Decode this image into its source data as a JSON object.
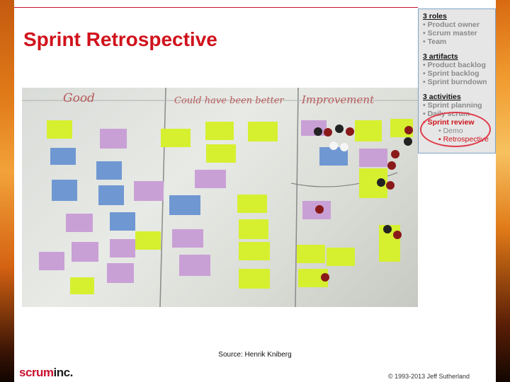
{
  "slide": {
    "title": "Sprint Retrospective",
    "source": "Source: Henrik Kniberg",
    "copyright": "© 1993-2013 Jeff Sutherland"
  },
  "logo": {
    "part1": "scrum",
    "part2": "inc."
  },
  "nav": {
    "groups": [
      {
        "heading": "3 roles",
        "items": [
          "• Product owner",
          "• Scrum master",
          "• Team"
        ]
      },
      {
        "heading": "3 artifacts",
        "items": [
          "• Product backlog",
          "• Sprint backlog",
          "• Sprint burndown"
        ]
      },
      {
        "heading": "3 activities",
        "items": [
          "• Sprint planning",
          "• Daily scrum",
          "• Sprint review"
        ]
      }
    ],
    "subitems": [
      "• Demo",
      "• Retrospective"
    ]
  },
  "board": {
    "columns": [
      "Good",
      "Could have been better",
      "Improvement"
    ]
  },
  "colors": {
    "accent": "#d0121b",
    "note_yellow": "#d6f030",
    "note_purple": "#c9a0d6",
    "note_blue": "#6f98d2"
  }
}
